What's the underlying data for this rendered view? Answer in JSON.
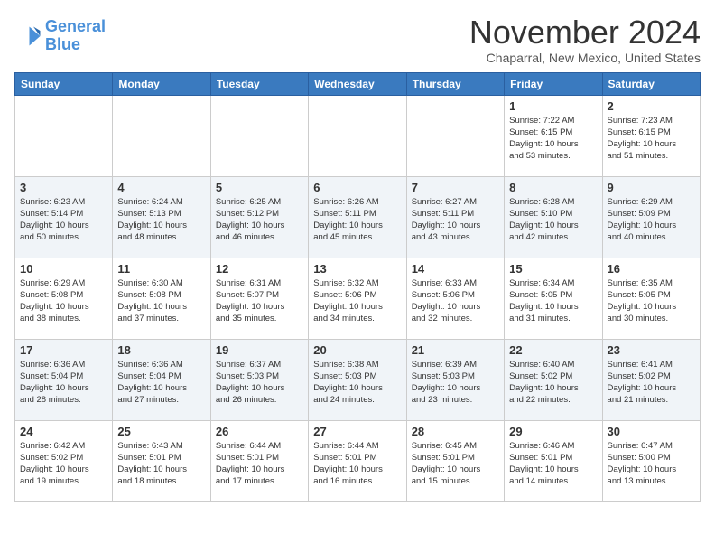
{
  "logo": {
    "line1": "General",
    "line2": "Blue"
  },
  "title": "November 2024",
  "location": "Chaparral, New Mexico, United States",
  "weekdays": [
    "Sunday",
    "Monday",
    "Tuesday",
    "Wednesday",
    "Thursday",
    "Friday",
    "Saturday"
  ],
  "weeks": [
    [
      {
        "day": "",
        "info": ""
      },
      {
        "day": "",
        "info": ""
      },
      {
        "day": "",
        "info": ""
      },
      {
        "day": "",
        "info": ""
      },
      {
        "day": "",
        "info": ""
      },
      {
        "day": "1",
        "info": "Sunrise: 7:22 AM\nSunset: 6:15 PM\nDaylight: 10 hours\nand 53 minutes."
      },
      {
        "day": "2",
        "info": "Sunrise: 7:23 AM\nSunset: 6:15 PM\nDaylight: 10 hours\nand 51 minutes."
      }
    ],
    [
      {
        "day": "3",
        "info": "Sunrise: 6:23 AM\nSunset: 5:14 PM\nDaylight: 10 hours\nand 50 minutes."
      },
      {
        "day": "4",
        "info": "Sunrise: 6:24 AM\nSunset: 5:13 PM\nDaylight: 10 hours\nand 48 minutes."
      },
      {
        "day": "5",
        "info": "Sunrise: 6:25 AM\nSunset: 5:12 PM\nDaylight: 10 hours\nand 46 minutes."
      },
      {
        "day": "6",
        "info": "Sunrise: 6:26 AM\nSunset: 5:11 PM\nDaylight: 10 hours\nand 45 minutes."
      },
      {
        "day": "7",
        "info": "Sunrise: 6:27 AM\nSunset: 5:11 PM\nDaylight: 10 hours\nand 43 minutes."
      },
      {
        "day": "8",
        "info": "Sunrise: 6:28 AM\nSunset: 5:10 PM\nDaylight: 10 hours\nand 42 minutes."
      },
      {
        "day": "9",
        "info": "Sunrise: 6:29 AM\nSunset: 5:09 PM\nDaylight: 10 hours\nand 40 minutes."
      }
    ],
    [
      {
        "day": "10",
        "info": "Sunrise: 6:29 AM\nSunset: 5:08 PM\nDaylight: 10 hours\nand 38 minutes."
      },
      {
        "day": "11",
        "info": "Sunrise: 6:30 AM\nSunset: 5:08 PM\nDaylight: 10 hours\nand 37 minutes."
      },
      {
        "day": "12",
        "info": "Sunrise: 6:31 AM\nSunset: 5:07 PM\nDaylight: 10 hours\nand 35 minutes."
      },
      {
        "day": "13",
        "info": "Sunrise: 6:32 AM\nSunset: 5:06 PM\nDaylight: 10 hours\nand 34 minutes."
      },
      {
        "day": "14",
        "info": "Sunrise: 6:33 AM\nSunset: 5:06 PM\nDaylight: 10 hours\nand 32 minutes."
      },
      {
        "day": "15",
        "info": "Sunrise: 6:34 AM\nSunset: 5:05 PM\nDaylight: 10 hours\nand 31 minutes."
      },
      {
        "day": "16",
        "info": "Sunrise: 6:35 AM\nSunset: 5:05 PM\nDaylight: 10 hours\nand 30 minutes."
      }
    ],
    [
      {
        "day": "17",
        "info": "Sunrise: 6:36 AM\nSunset: 5:04 PM\nDaylight: 10 hours\nand 28 minutes."
      },
      {
        "day": "18",
        "info": "Sunrise: 6:36 AM\nSunset: 5:04 PM\nDaylight: 10 hours\nand 27 minutes."
      },
      {
        "day": "19",
        "info": "Sunrise: 6:37 AM\nSunset: 5:03 PM\nDaylight: 10 hours\nand 26 minutes."
      },
      {
        "day": "20",
        "info": "Sunrise: 6:38 AM\nSunset: 5:03 PM\nDaylight: 10 hours\nand 24 minutes."
      },
      {
        "day": "21",
        "info": "Sunrise: 6:39 AM\nSunset: 5:03 PM\nDaylight: 10 hours\nand 23 minutes."
      },
      {
        "day": "22",
        "info": "Sunrise: 6:40 AM\nSunset: 5:02 PM\nDaylight: 10 hours\nand 22 minutes."
      },
      {
        "day": "23",
        "info": "Sunrise: 6:41 AM\nSunset: 5:02 PM\nDaylight: 10 hours\nand 21 minutes."
      }
    ],
    [
      {
        "day": "24",
        "info": "Sunrise: 6:42 AM\nSunset: 5:02 PM\nDaylight: 10 hours\nand 19 minutes."
      },
      {
        "day": "25",
        "info": "Sunrise: 6:43 AM\nSunset: 5:01 PM\nDaylight: 10 hours\nand 18 minutes."
      },
      {
        "day": "26",
        "info": "Sunrise: 6:44 AM\nSunset: 5:01 PM\nDaylight: 10 hours\nand 17 minutes."
      },
      {
        "day": "27",
        "info": "Sunrise: 6:44 AM\nSunset: 5:01 PM\nDaylight: 10 hours\nand 16 minutes."
      },
      {
        "day": "28",
        "info": "Sunrise: 6:45 AM\nSunset: 5:01 PM\nDaylight: 10 hours\nand 15 minutes."
      },
      {
        "day": "29",
        "info": "Sunrise: 6:46 AM\nSunset: 5:01 PM\nDaylight: 10 hours\nand 14 minutes."
      },
      {
        "day": "30",
        "info": "Sunrise: 6:47 AM\nSunset: 5:00 PM\nDaylight: 10 hours\nand 13 minutes."
      }
    ]
  ]
}
